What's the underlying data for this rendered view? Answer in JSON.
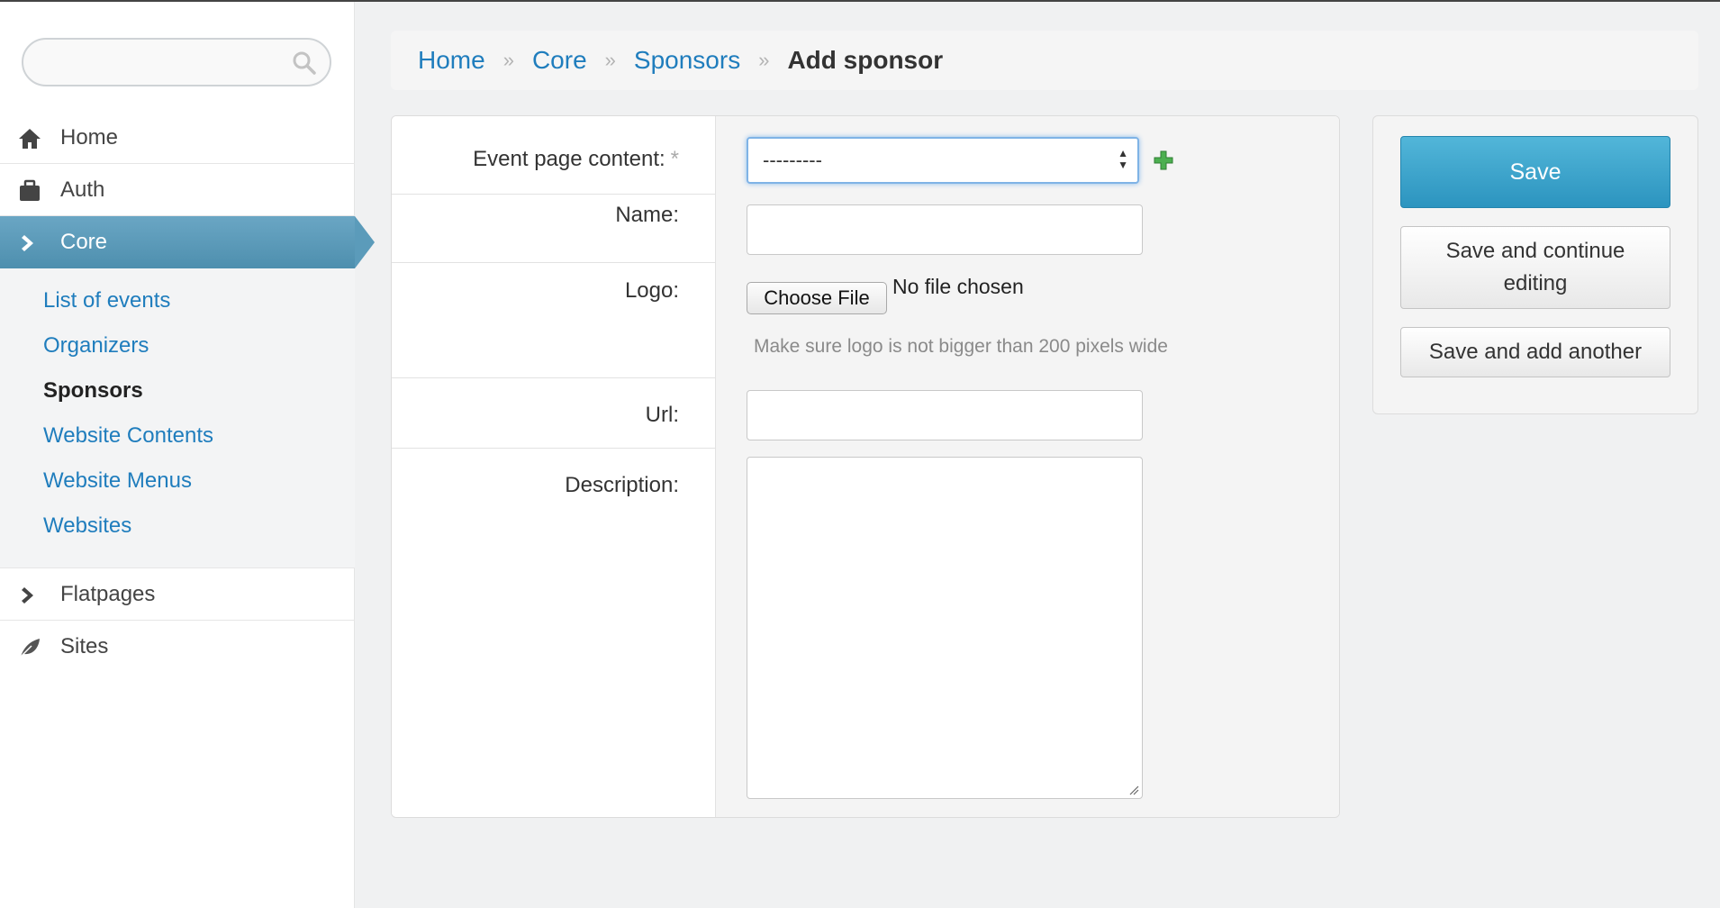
{
  "sidebar": {
    "search": {
      "placeholder": "",
      "value": ""
    },
    "top_items": [
      {
        "label": "Home",
        "icon": "home-icon"
      },
      {
        "label": "Auth",
        "icon": "briefcase-icon"
      },
      {
        "label": "Core",
        "icon": "chevron-right-icon",
        "active": true
      }
    ],
    "core_subitems": [
      {
        "label": "List of events"
      },
      {
        "label": "Organizers"
      },
      {
        "label": "Sponsors",
        "current": true
      },
      {
        "label": "Website Contents"
      },
      {
        "label": "Website Menus"
      },
      {
        "label": "Websites"
      }
    ],
    "bottom_items": [
      {
        "label": "Flatpages",
        "icon": "chevron-right-icon"
      },
      {
        "label": "Sites",
        "icon": "leaf-icon"
      }
    ]
  },
  "breadcrumb": {
    "items": [
      "Home",
      "Core",
      "Sponsors"
    ],
    "separator": "»",
    "current": "Add sponsor"
  },
  "form": {
    "fields": {
      "event_page_content": {
        "label": "Event page content:",
        "required_mark": "*",
        "selected": "---------"
      },
      "name": {
        "label": "Name:",
        "value": ""
      },
      "logo": {
        "label": "Logo:",
        "button": "Choose File",
        "status": "No file chosen",
        "help": "Make sure logo is not bigger than 200 pixels wide"
      },
      "url": {
        "label": "Url:",
        "value": ""
      },
      "description": {
        "label": "Description:",
        "value": ""
      }
    }
  },
  "actions": {
    "save": "Save",
    "save_continue": "Save and continue editing",
    "save_add": "Save and add another"
  },
  "colors": {
    "link": "#1f7dbd",
    "active_nav": "#5b9bba",
    "save_button": "#3aa3cc",
    "add_icon": "#4caf50"
  }
}
